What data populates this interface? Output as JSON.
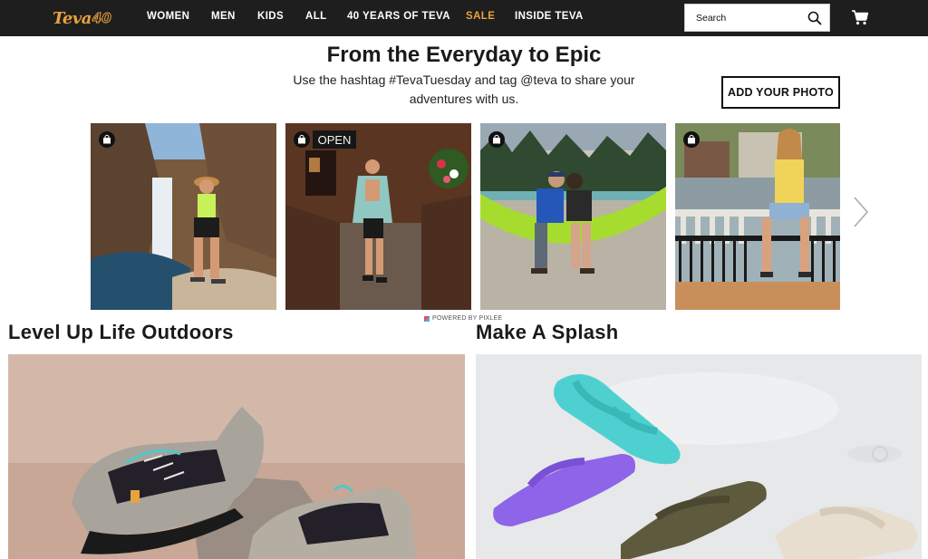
{
  "header": {
    "logo_text": "Teva",
    "logo_badge": "40",
    "nav": [
      {
        "label": "WOMEN"
      },
      {
        "label": "MEN"
      },
      {
        "label": "KIDS"
      },
      {
        "label": "ALL"
      },
      {
        "label": "40 YEARS OF TEVA"
      },
      {
        "label": "SALE"
      },
      {
        "label": "INSIDE TEVA"
      }
    ],
    "search": {
      "placeholder": "Search"
    },
    "colors": {
      "bar": "#1e1e1e",
      "accent": "#e8a33c"
    }
  },
  "ugc": {
    "title": "From the Everyday to Epic",
    "subtitle": "Use the hashtag #TevaTuesday and tag @teva to share your adventures with us.",
    "add_photo_label": "ADD YOUR PHOTO",
    "photos": [
      {
        "alt": "Woman standing by a waterfall",
        "shop_icon": "shopping-bag-icon"
      },
      {
        "alt": "Woman at a doorway with OPEN sign",
        "shop_icon": "shopping-bag-icon",
        "sign_text": "OPEN"
      },
      {
        "alt": "Couple in a green hammock",
        "shop_icon": "shopping-bag-icon"
      },
      {
        "alt": "Woman sitting on a railing",
        "shop_icon": "shopping-bag-icon"
      }
    ],
    "powered_by": "POWERED BY PIXLEE"
  },
  "sections": [
    {
      "title": "Level Up Life Outdoors"
    },
    {
      "title": "Make A Splash"
    }
  ]
}
